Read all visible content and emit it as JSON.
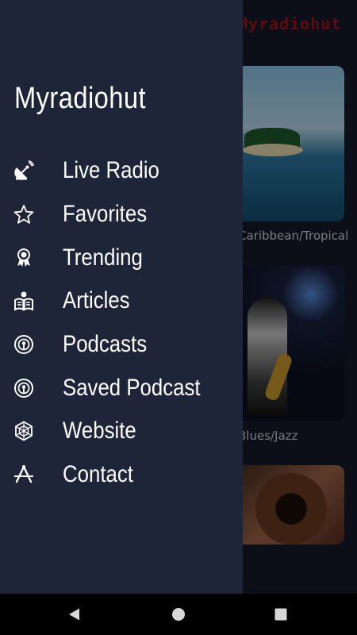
{
  "background": {
    "app_title": "Myradiohut",
    "cards": [
      {
        "label": "Caribbean/Tropical"
      },
      {
        "label": "Blues/Jazz"
      },
      {
        "label": ""
      }
    ]
  },
  "drawer": {
    "title": "Myradiohut",
    "items": [
      {
        "label": "Live Radio",
        "icon": "satellite-dish-icon"
      },
      {
        "label": "Favorites",
        "icon": "star-icon"
      },
      {
        "label": "Trending",
        "icon": "award-ribbon-icon"
      },
      {
        "label": "Articles",
        "icon": "reader-icon"
      },
      {
        "label": "Podcasts",
        "icon": "podcast-icon"
      },
      {
        "label": "Saved Podcast",
        "icon": "podcast-icon"
      },
      {
        "label": "Website",
        "icon": "web-icon"
      },
      {
        "label": "Contact",
        "icon": "contact-icon"
      }
    ]
  },
  "system_nav": {
    "back": "back-icon",
    "home": "home-icon",
    "recents": "recents-icon"
  },
  "colors": {
    "drawer_bg": "#1e2538",
    "text": "#ffffff",
    "brand_red": "#a0141c",
    "nav_bar": "#000000"
  }
}
